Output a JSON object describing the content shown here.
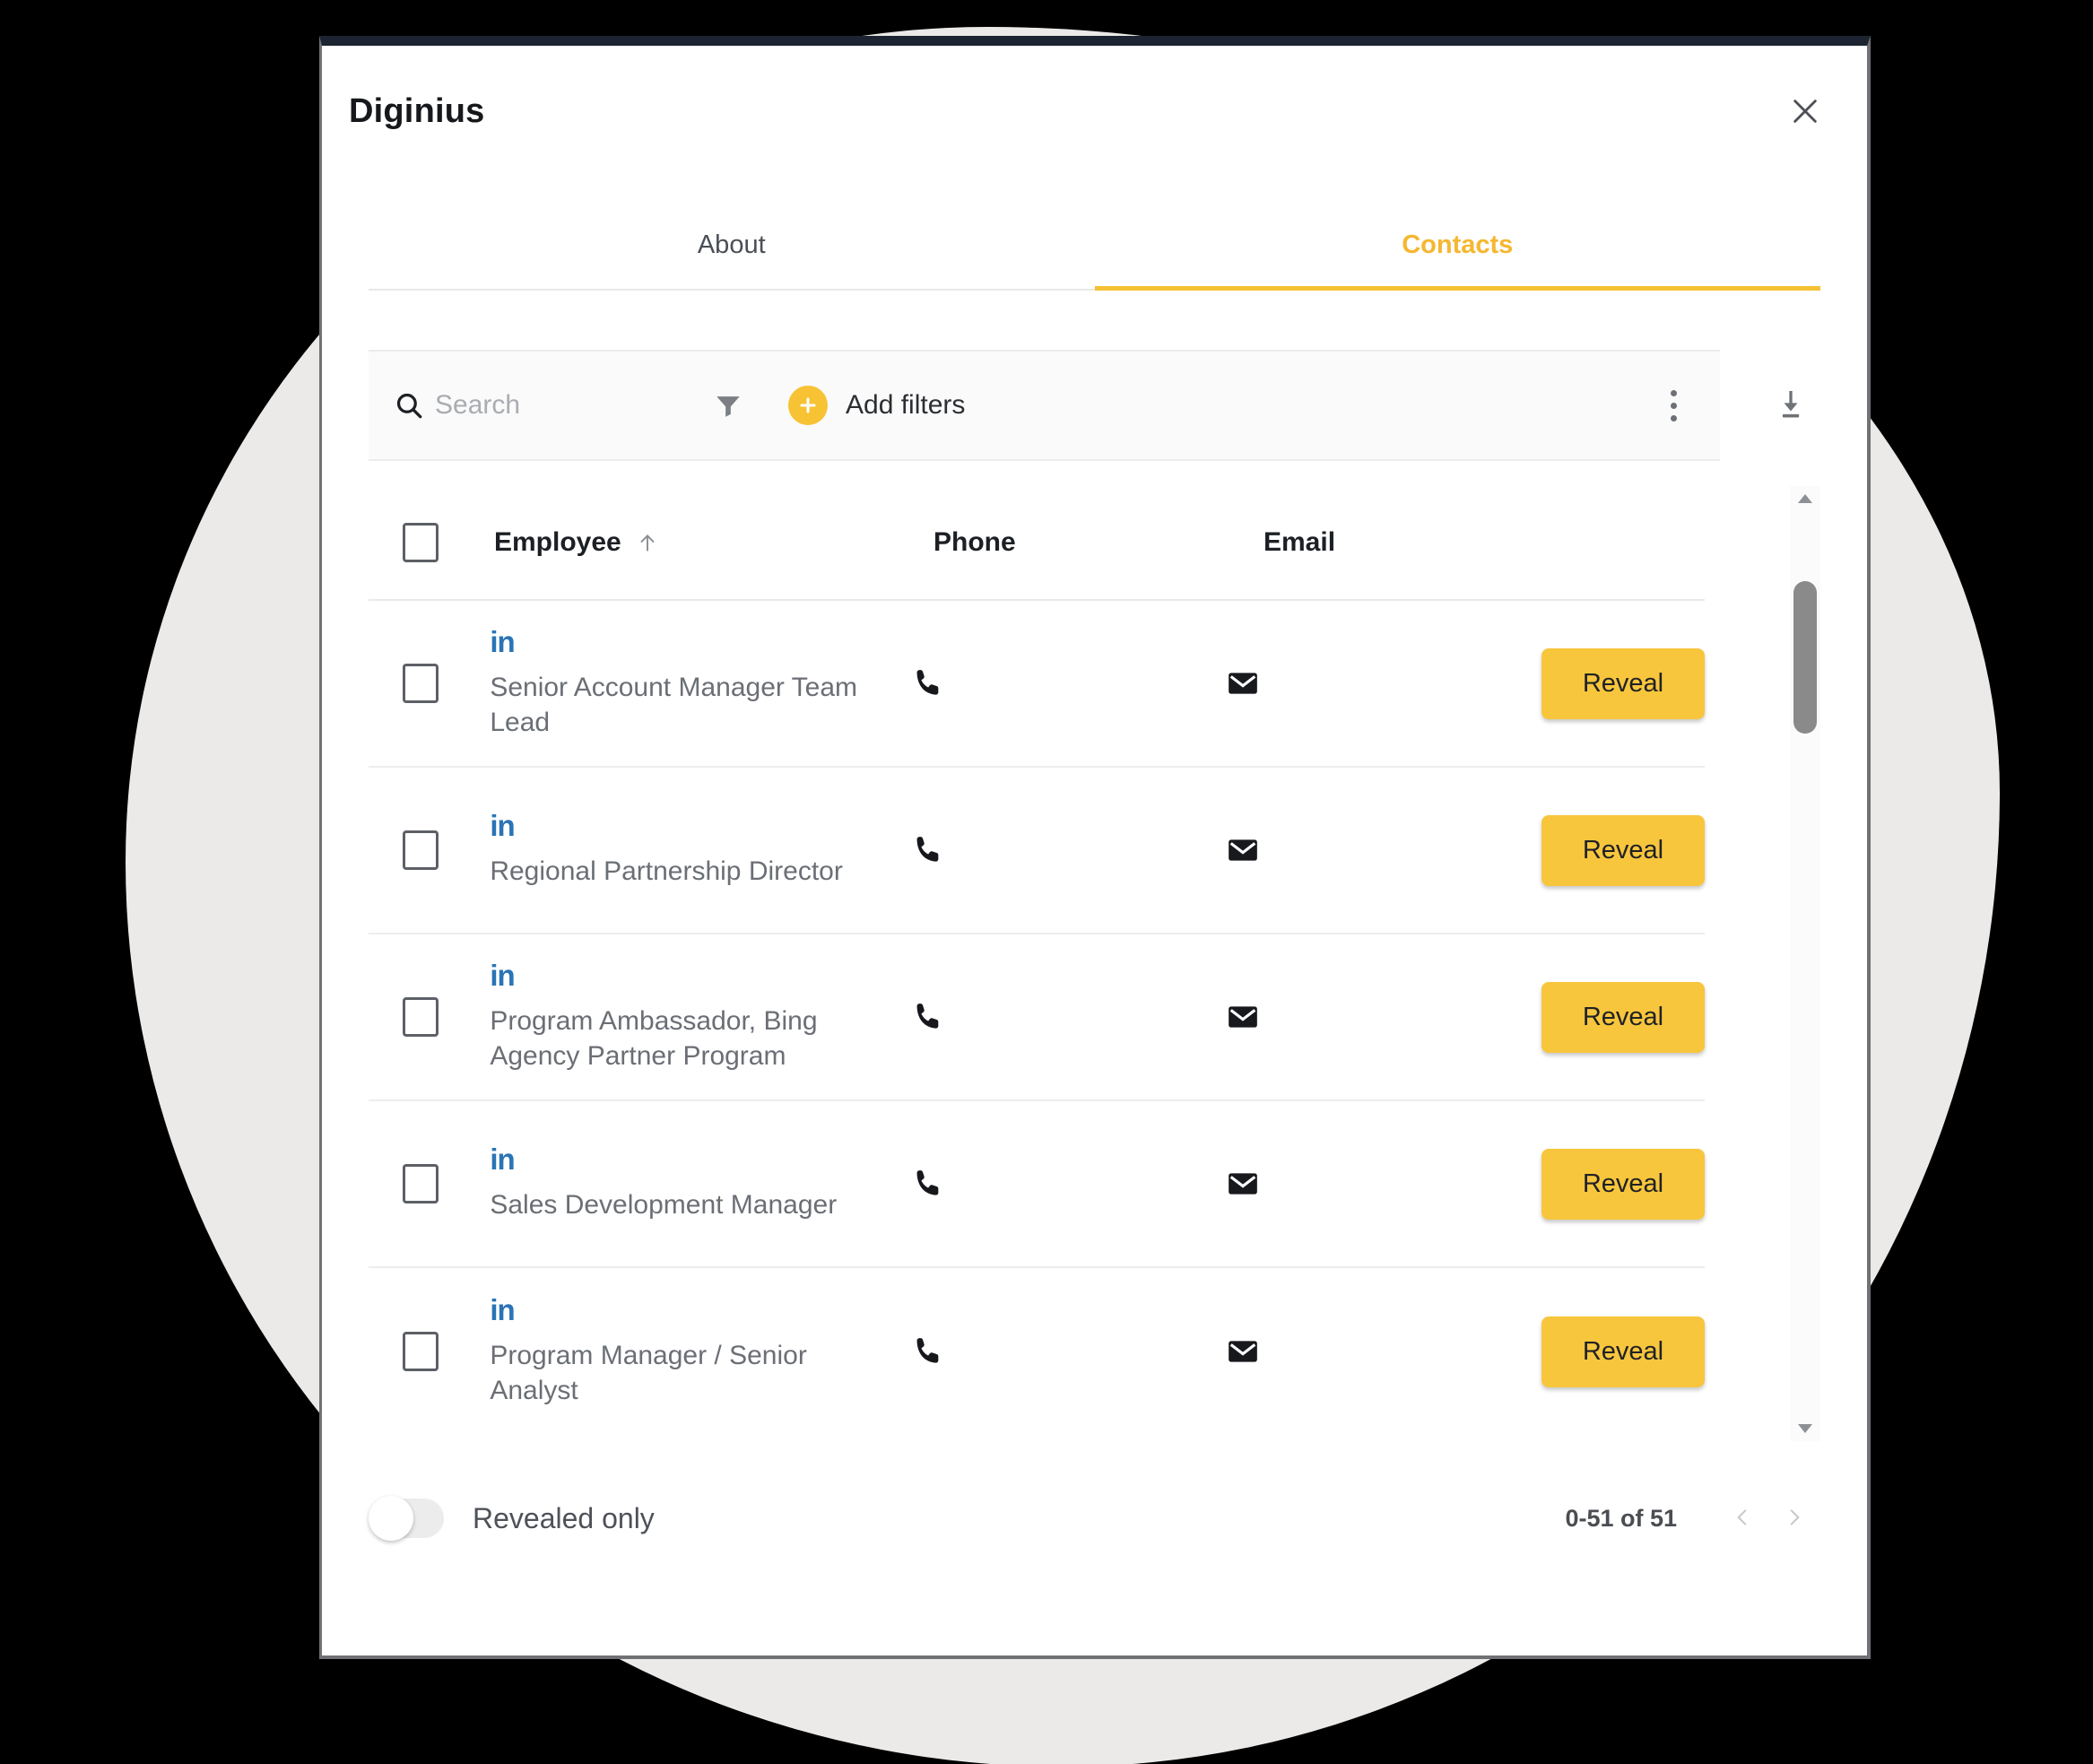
{
  "window": {
    "title": "Diginius",
    "close_icon": "close-icon"
  },
  "tabs": [
    {
      "label": "About",
      "active": false
    },
    {
      "label": "Contacts",
      "active": true
    }
  ],
  "toolbar": {
    "search_placeholder": "Search",
    "search_value": "",
    "search_icon": "search-icon",
    "filter_icon": "funnel-icon",
    "add_filters_label": "Add filters",
    "add_filters_icon": "plus-circle-icon",
    "more_icon": "kebab-menu-icon",
    "download_icon": "download-icon"
  },
  "table": {
    "columns": {
      "employee": "Employee",
      "phone": "Phone",
      "email": "Email"
    },
    "sort": {
      "column": "Employee",
      "direction": "asc",
      "icon": "arrow-up-icon"
    },
    "reveal_label": "Reveal",
    "linkedin_label": "in",
    "rows": [
      {
        "title": "Senior Account Manager Team Lead",
        "linkedin": "in",
        "phone_icon": "phone-icon",
        "email_icon": "email-icon",
        "action": "Reveal"
      },
      {
        "title": "Regional Partnership Director",
        "linkedin": "in",
        "phone_icon": "phone-icon",
        "email_icon": "email-icon",
        "action": "Reveal"
      },
      {
        "title": "Program Ambassador, Bing Agency Partner Program",
        "linkedin": "in",
        "phone_icon": "phone-icon",
        "email_icon": "email-icon",
        "action": "Reveal"
      },
      {
        "title": "Sales Development Manager",
        "linkedin": "in",
        "phone_icon": "phone-icon",
        "email_icon": "email-icon",
        "action": "Reveal"
      },
      {
        "title": "Program Manager / Senior Analyst",
        "linkedin": "in",
        "phone_icon": "phone-icon",
        "email_icon": "email-icon",
        "action": "Reveal"
      }
    ]
  },
  "footer": {
    "toggle_label": "Revealed only",
    "toggle_on": false,
    "pagination": "0-51 of 51",
    "prev_icon": "chevron-left-icon",
    "next_icon": "chevron-right-icon"
  },
  "colors": {
    "accent": "#f5c133",
    "reveal": "#f8c63c",
    "linkedin": "#2a74b6",
    "tab_active": "#f5b731",
    "background": "#000000",
    "blob": "#ebeae8",
    "modal_top_border": "#1b2430"
  }
}
